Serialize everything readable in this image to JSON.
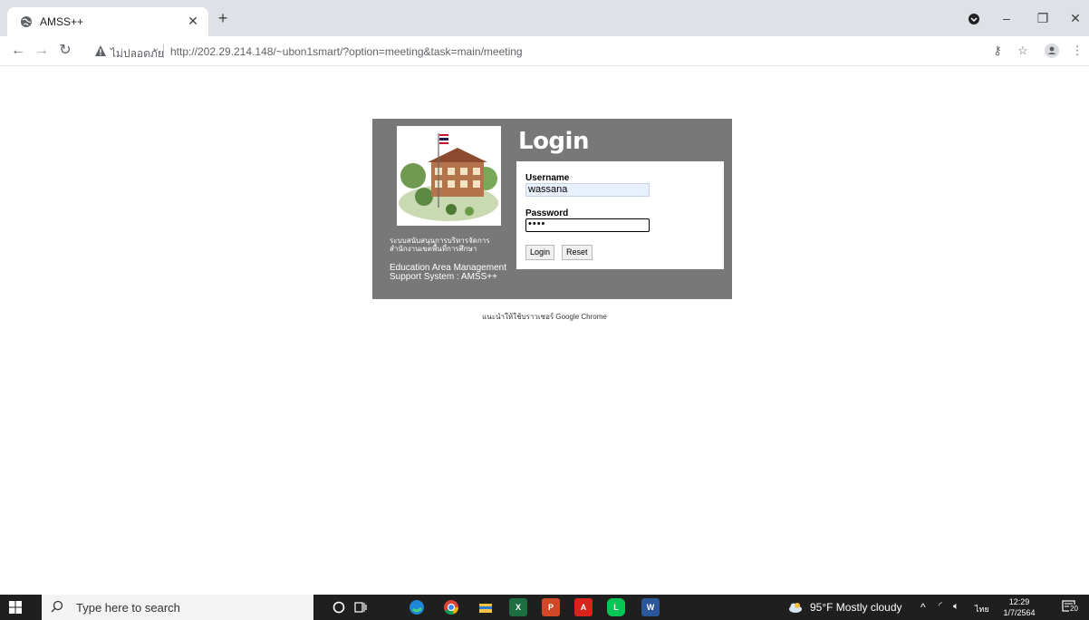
{
  "browser": {
    "tab_title": "AMSS++",
    "security_warning": "ไม่ปลอดภัย",
    "url": "http://202.29.214.148/~ubon1smart/?option=meeting&task=main/meeting"
  },
  "login": {
    "title": "Login",
    "username_label": "Username",
    "username_value": "wassana",
    "password_label": "Password",
    "password_value": "••••",
    "login_button": "Login",
    "reset_button": "Reset",
    "system_name_th_1": "ระบบสนับสนุนการบริหารจัดการ",
    "system_name_th_2": "สำนักงานเขตพื้นที่การศึกษา",
    "system_name_en_1": "Education Area Management",
    "system_name_en_2": "Support System : AMSS++",
    "browser_hint": "แนะนำให้ใช้บราวเซอร์ Google Chrome"
  },
  "taskbar": {
    "search_placeholder": "Type here to search",
    "weather": "95°F  Mostly cloudy",
    "language": "ไทย",
    "time": "12:29",
    "date": "1/7/2564",
    "notification_count": "20"
  }
}
